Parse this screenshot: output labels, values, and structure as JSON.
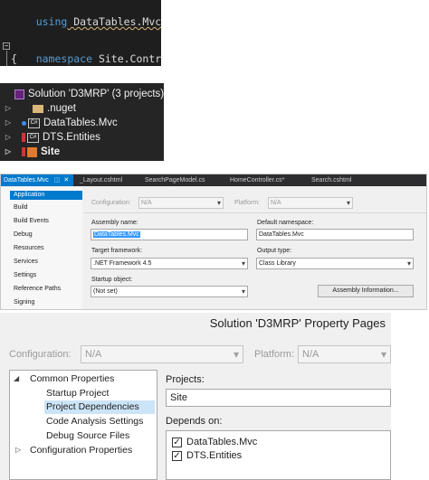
{
  "code_editor": {
    "line1_keyword": "using",
    "line1_rest": " DataTables.Mvc;",
    "line2_keyword": "namespace",
    "line2_rest": " Site.Controllers",
    "line3": "{"
  },
  "solution_explorer": {
    "items": [
      {
        "label": "Solution 'D3MRP' (3 projects)",
        "icon": "solution-icon"
      },
      {
        "label": ".nuget",
        "icon": "folder-icon"
      },
      {
        "label": "DataTables.Mvc",
        "icon": "csharp-project-icon"
      },
      {
        "label": "DTS.Entities",
        "icon": "csharp-project-icon"
      },
      {
        "label": "Site",
        "icon": "web-project-icon"
      }
    ],
    "icon_badge": "C#"
  },
  "project_properties": {
    "tabs": [
      "DataTables.Mvc",
      "_Layout.cshtml",
      "SearchPageModel.cs",
      "HomeController.cs*",
      "Search.cshtml"
    ],
    "tab_close_glyph": "✕",
    "nav": [
      "Application",
      "Build",
      "Build Events",
      "Debug",
      "Resources",
      "Services",
      "Settings",
      "Reference Paths",
      "Signing"
    ],
    "configuration_label": "Configuration:",
    "configuration_value": "N/A",
    "platform_label": "Platform:",
    "platform_value": "N/A",
    "assembly_name_label": "Assembly name:",
    "assembly_name_value": "DataTables.Mvc",
    "default_namespace_label": "Default namespace:",
    "default_namespace_value": "DataTables.Mvc",
    "target_framework_label": "Target framework:",
    "target_framework_value": ".NET Framework 4.5",
    "output_type_label": "Output type:",
    "output_type_value": "Class Library",
    "startup_object_label": "Startup object:",
    "startup_object_value": "(Not set)",
    "assembly_info_button": "Assembly Information..."
  },
  "solution_property_pages": {
    "title": "Solution 'D3MRP' Property Pages",
    "configuration_label": "Configuration:",
    "configuration_value": "N/A",
    "platform_label": "Platform:",
    "platform_value": "N/A",
    "tree": [
      "Common Properties",
      "Startup Project",
      "Project Dependencies",
      "Code Analysis Settings",
      "Debug Source Files",
      "Configuration Properties"
    ],
    "projects_label": "Projects:",
    "projects_value": "Site",
    "depends_on_label": "Depends on:",
    "dependencies": [
      {
        "label": "DataTables.Mvc",
        "checked": true
      },
      {
        "label": "DTS.Entities",
        "checked": true
      }
    ],
    "check_glyph": "✓"
  }
}
